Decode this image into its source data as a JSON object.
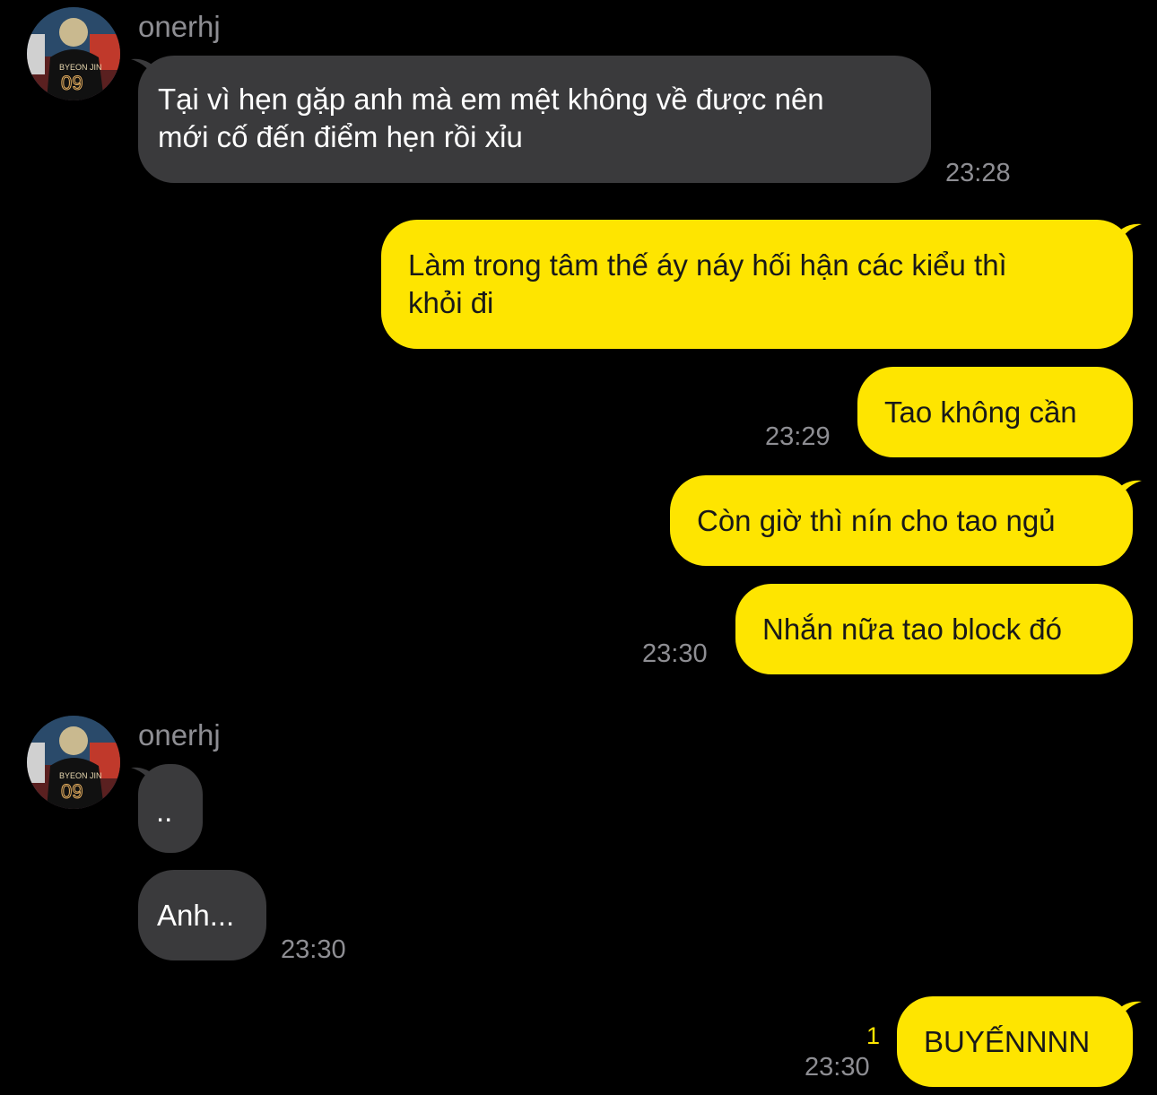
{
  "colors": {
    "background": "#000000",
    "incoming_bubble": "#3a3a3c",
    "outgoing_bubble": "#fee500",
    "timestamp": "#8e8e93",
    "unread": "#fee500"
  },
  "chat": {
    "groups": [
      {
        "sender": "onerhj",
        "avatar_icon": "profile-photo-icon",
        "messages": [
          {
            "text_lines": [
              "Tại vì hẹn gặp anh mà em mệt không về được nên",
              "mới cố đến điểm hẹn rồi xỉu"
            ],
            "time": "23:28"
          }
        ]
      }
    ],
    "outgoing_block_1": [
      {
        "text_lines": [
          "Làm trong tâm thế áy náy hối hận các kiểu thì",
          "khỏi đi"
        ]
      },
      {
        "text_lines": [
          "Tao không cần"
        ],
        "time": "23:29"
      },
      {
        "text_lines": [
          "Còn giờ thì nín cho tao ngủ"
        ]
      },
      {
        "text_lines": [
          "Nhắn nữa tao block đó"
        ],
        "time": "23:30"
      }
    ],
    "incoming_block_2": {
      "sender": "onerhj",
      "avatar_icon": "profile-photo-icon",
      "messages": [
        {
          "text_lines": [
            ".."
          ]
        },
        {
          "text_lines": [
            "Anh..."
          ],
          "time": "23:30"
        }
      ]
    },
    "outgoing_block_2": [
      {
        "text_lines": [
          "BUYẾNNNN"
        ],
        "time": "23:30",
        "unread_count": "1"
      }
    ]
  }
}
